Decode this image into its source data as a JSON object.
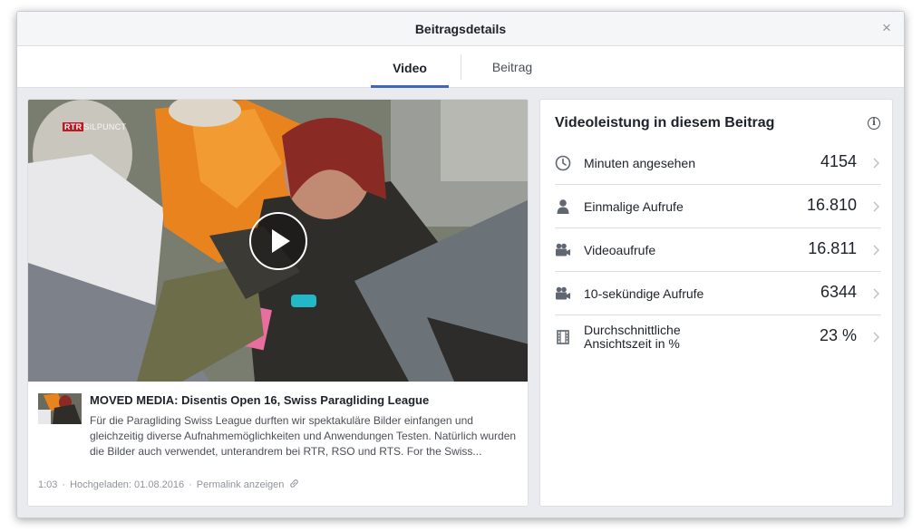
{
  "dialog": {
    "title": "Beitragsdetails",
    "close_glyph": "×"
  },
  "tabs": [
    {
      "label": "Video",
      "active": true
    },
    {
      "label": "Beitrag",
      "active": false
    }
  ],
  "video": {
    "channel_logo_prefix": "RTR",
    "channel_logo_suffix": "SILPUNCT",
    "play_icon": "play-icon"
  },
  "post": {
    "title": "MOVED MEDIA: Disentis Open 16, Swiss Paragliding League",
    "description": "Für die Paragliding Swiss League durften wir spektakuläre Bilder einfangen und gleichzeitig diverse Aufnahmemöglichkeiten und Anwendungen Testen. Natürlich wurden die Bilder auch verwendet, unterandrem bei RTR, RSO und RTS. For the Swiss...",
    "duration": "1:03",
    "uploaded": "Hochgeladen: 01.08.2016",
    "permalink": "Permalink anzeigen"
  },
  "performance": {
    "title": "Videoleistung in diesem Beitrag",
    "metrics": [
      {
        "icon": "clock-icon",
        "label": "Minuten angesehen",
        "value": "4154"
      },
      {
        "icon": "person-icon",
        "label": "Einmalige Aufrufe",
        "value": "16.810"
      },
      {
        "icon": "video-camera-icon",
        "label": "Videoaufrufe",
        "value": "16.811"
      },
      {
        "icon": "video-camera-icon",
        "label": "10-sekündige Aufrufe",
        "value": "6344"
      },
      {
        "icon": "film-icon",
        "label": "Durchschnittliche Ansichtszeit in %",
        "value": "23 %"
      }
    ]
  },
  "colors": {
    "accent": "#4267b2",
    "border": "#dddfe2",
    "background": "#e9ebee",
    "text_primary": "#1d2129",
    "text_secondary": "#90949c"
  }
}
